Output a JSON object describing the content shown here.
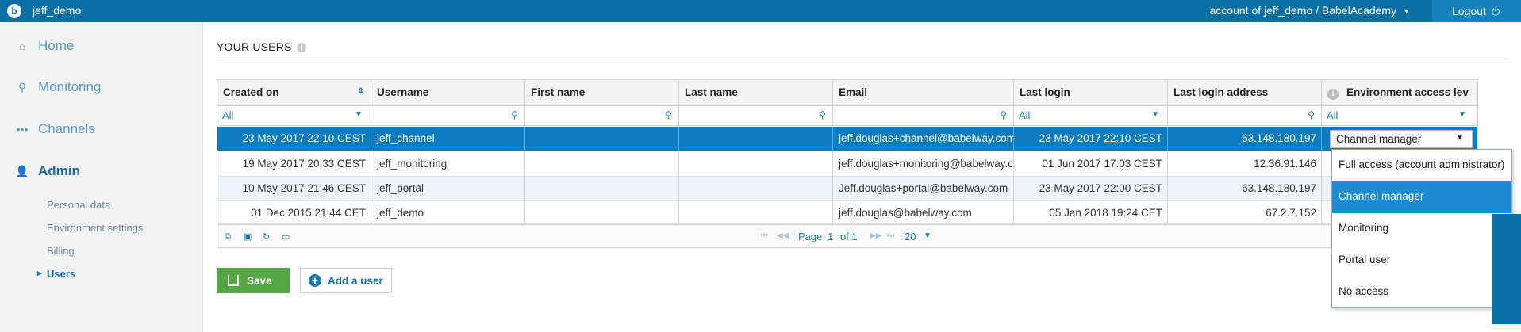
{
  "topbar": {
    "logo": "b",
    "app_name": "jeff_demo",
    "account": "account of jeff_demo / BabelAcademy",
    "logout": "Logout"
  },
  "sidebar": {
    "items": [
      {
        "label": "Home",
        "icon": "home-icon"
      },
      {
        "label": "Monitoring",
        "icon": "search-icon"
      },
      {
        "label": "Channels",
        "icon": "channels-icon"
      },
      {
        "label": "Admin",
        "icon": "user-icon"
      }
    ],
    "admin_sub": [
      "Personal data",
      "Environment settings",
      "Billing",
      "Users"
    ]
  },
  "page": {
    "title": "YOUR USERS"
  },
  "grid": {
    "columns": [
      "Created on",
      "Username",
      "First name",
      "Last name",
      "Email",
      "Last login",
      "Last login address",
      "Environment access lev"
    ],
    "filters": {
      "created_on": "All",
      "last_login": "All",
      "access": "All"
    },
    "rows": [
      {
        "created": "23 May 2017 22:10 CEST",
        "username": "jeff_channel",
        "first": "",
        "last": "",
        "email": "jeff.douglas+channel@babelway.com",
        "last_login": "23 May 2017 22:10 CEST",
        "address": "63.148.180.197",
        "access": "Channel manager"
      },
      {
        "created": "19 May 2017 20:33 CEST",
        "username": "jeff_monitoring",
        "first": "",
        "last": "",
        "email": "jeff.douglas+monitoring@babelway.com",
        "last_login": "01 Jun 2017 17:03 CEST",
        "address": "12.36.91.146",
        "access": ""
      },
      {
        "created": "10 May 2017 21:46 CEST",
        "username": "jeff_portal",
        "first": "",
        "last": "",
        "email": "Jeff.douglas+portal@babelway.com",
        "last_login": "23 May 2017 22:00 CEST",
        "address": "63.148.180.197",
        "access": ""
      },
      {
        "created": "01 Dec 2015 21:44 CET",
        "username": "jeff_demo",
        "first": "",
        "last": "",
        "email": "jeff.douglas@babelway.com",
        "last_login": "05 Jan 2018 19:24 CET",
        "address": "67.2.7.152",
        "access": ""
      }
    ],
    "pager": {
      "page_label": "Page",
      "page": "1",
      "of_label": "of 1",
      "page_size": "20"
    }
  },
  "access_options": [
    "Full access (account administrator)",
    "Channel manager",
    "Monitoring",
    "Portal user",
    "No access"
  ],
  "access_selected": "Channel manager",
  "buttons": {
    "save": "Save",
    "add_user": "Add a user"
  },
  "colors": {
    "brand": "#0b6fa4",
    "selected_row": "#0b7cc0",
    "save": "#55a644"
  }
}
